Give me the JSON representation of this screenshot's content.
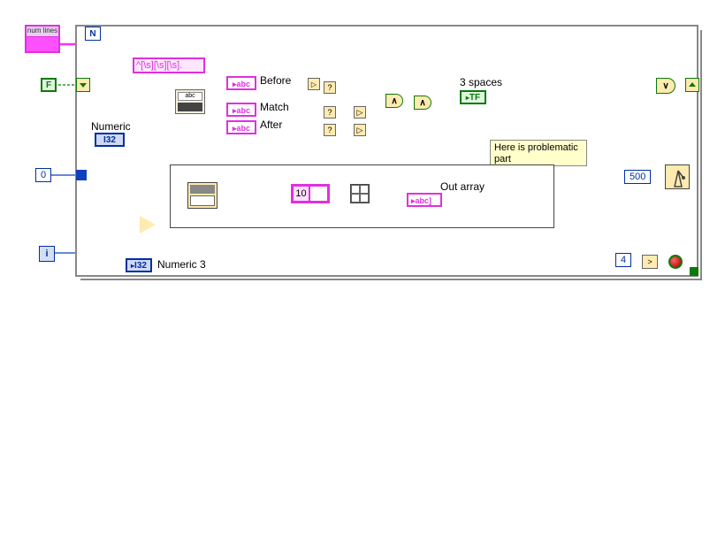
{
  "regex_pattern": "^[\\s][\\s][\\s].",
  "labels": {
    "numeric": "Numeric",
    "numeric3": "Numeric 3",
    "before": "Before",
    "match": "Match",
    "after": "After",
    "three_spaces": "3 spaces",
    "out_array": "Out array",
    "annotation": "Here is problematic part",
    "numlines": "num lines"
  },
  "constants": {
    "zero": "0",
    "ten": "10",
    "four": "4",
    "five_hundred": "500",
    "false": "F"
  },
  "indicators": {
    "i32": "I32",
    "tf": "TF",
    "abc": "abc"
  },
  "loop": {
    "n_terminal": "N",
    "iter_terminal": "i"
  },
  "ops": {
    "and": "∧",
    "or": "∨",
    "question": "?",
    "gt": ">"
  }
}
